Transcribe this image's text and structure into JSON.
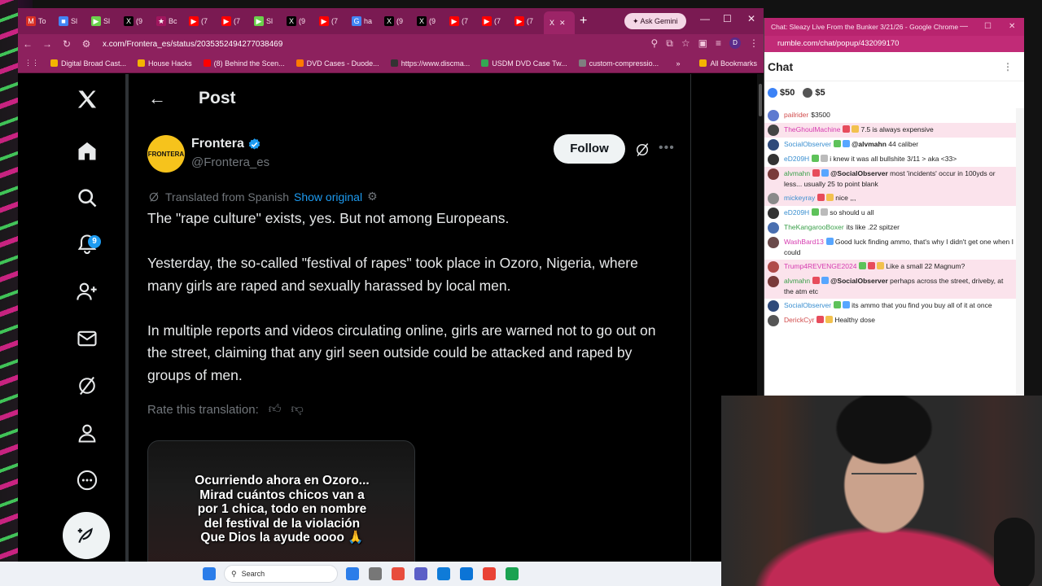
{
  "browser": {
    "tabs": [
      {
        "label": "To",
        "color": "#d93025",
        "fav": "M"
      },
      {
        "label": "Sl",
        "color": "#4285f4",
        "fav": "■"
      },
      {
        "label": "Sl",
        "color": "#6bd14b",
        "fav": "▶"
      },
      {
        "label": "(9",
        "color": "#000000",
        "fav": "X"
      },
      {
        "label": "Bc",
        "color": "#a0165e",
        "fav": "★"
      },
      {
        "label": "(7",
        "color": "#ff0000",
        "fav": "▶"
      },
      {
        "label": "(7",
        "color": "#ff0000",
        "fav": "▶"
      },
      {
        "label": "Sl",
        "color": "#6bd14b",
        "fav": "▶"
      },
      {
        "label": "(9",
        "color": "#000000",
        "fav": "X"
      },
      {
        "label": "(7",
        "color": "#ff0000",
        "fav": "▶"
      },
      {
        "label": "ha",
        "color": "#4285f4",
        "fav": "G"
      },
      {
        "label": "(9",
        "color": "#000000",
        "fav": "X"
      },
      {
        "label": "(9",
        "color": "#000000",
        "fav": "X"
      },
      {
        "label": "(7",
        "color": "#ff0000",
        "fav": "▶"
      },
      {
        "label": "(7",
        "color": "#ff0000",
        "fav": "▶"
      },
      {
        "label": "(7",
        "color": "#ff0000",
        "fav": "▶"
      }
    ],
    "active_tab_icon": "X",
    "new_tab": "+",
    "gemini_label": "Ask Gemini",
    "url": "x.com/Frontera_es/status/2035352494277038469",
    "avatar_letter": "D",
    "bookmarks": [
      {
        "label": "Digital Broad Cast...",
        "color": "#f4b400"
      },
      {
        "label": "House Hacks",
        "color": "#f4b400"
      },
      {
        "label": "(8) Behind the Scen...",
        "color": "#ff0000"
      },
      {
        "label": "DVD Cases - Duode...",
        "color": "#ff7a00"
      },
      {
        "label": "https://www.discma...",
        "color": "#333333"
      },
      {
        "label": "USDM DVD Case Tw...",
        "color": "#34a853"
      },
      {
        "label": "custom-compressio...",
        "color": "#7f7f7f"
      }
    ],
    "all_bookmarks": "All Bookmarks"
  },
  "x": {
    "notif_count": "9",
    "post_title": "Post",
    "author": {
      "avatar_text": "FRONTERA",
      "name": "Frontera",
      "handle": "@Frontera_es",
      "follow": "Follow"
    },
    "translated_label": "Translated from Spanish",
    "show_original": "Show original",
    "paragraphs": [
      "The \"rape culture\" exists, yes. But not among Europeans.",
      "Yesterday, the so-called \"festival of rapes\" took place in Ozoro, Nigeria, where many girls are raped and sexually harassed by local men.",
      "In multiple reports and videos circulating online, girls are warned not to go out on the street, claiming that any girl seen outside could be attacked and raped by groups of men."
    ],
    "rate_label": "Rate this translation:",
    "media_caption": [
      "Ocurriendo ahora en Ozoro...",
      "Mirad cuántos chicos van a",
      "por 1 chica, todo en nombre",
      "del festival de la violación",
      "Que Dios la ayude oooo 🙏"
    ],
    "colors": {
      "accent": "#1d9bf0",
      "background": "#000000"
    }
  },
  "chat": {
    "titlebar": "Chat: Sleazy Live From the Bunker 3/21/26 - Google Chrome",
    "url": "rumble.com/chat/popup/432099170",
    "header": "Chat",
    "rants": [
      {
        "amount": "$50",
        "color": "#3b82f6"
      },
      {
        "amount": "$5",
        "color": "#555555"
      }
    ],
    "messages": [
      {
        "user": "pailrider",
        "color": "#d14b4b",
        "av": "#5e7ad0",
        "badges": [],
        "mention": "",
        "text": "$3500",
        "hl": false
      },
      {
        "user": "TheGhoulMachine",
        "color": "#d63bb0",
        "av": "#444444",
        "badges": [
          "#e74c5c",
          "#f2c14e"
        ],
        "mention": "",
        "text": "7.5 is always expensive",
        "hl": true
      },
      {
        "user": "SocialObserver",
        "color": "#3a8fd0",
        "av": "#2f4a7a",
        "badges": [
          "#5ec25a",
          "#57a6ff"
        ],
        "mention": "@alvmahn",
        "text": "44 caliber",
        "hl": false
      },
      {
        "user": "eD209H",
        "color": "#3a8fd0",
        "av": "#333333",
        "badges": [
          "#5ec25a",
          "#bbbbbb"
        ],
        "mention": "",
        "text": "i knew it was all bullshite 3/11 > aka <33>",
        "hl": false
      },
      {
        "user": "alvmahn",
        "color": "#3aa04a",
        "av": "#7a3a3a",
        "badges": [
          "#e74c5c",
          "#57a6ff"
        ],
        "mention": "@SocialObserver",
        "text": "most 'incidents' occur in 100yds or less... usually 25 to point blank",
        "hl": true
      },
      {
        "user": "mickeyray",
        "color": "#3a8fd0",
        "av": "#8a8a8a",
        "badges": [
          "#e74c5c",
          "#f2c14e"
        ],
        "mention": "",
        "text": "nice ,,,",
        "hl": true
      },
      {
        "user": "eD209H",
        "color": "#3a8fd0",
        "av": "#333333",
        "badges": [
          "#5ec25a",
          "#bbbbbb"
        ],
        "mention": "",
        "text": "so should u all",
        "hl": false
      },
      {
        "user": "TheKangarooBoxer",
        "color": "#3aa04a",
        "av": "#4a6fb0",
        "badges": [],
        "mention": "",
        "text": "its like .22 spitzer",
        "hl": false
      },
      {
        "user": "WashBard13",
        "color": "#d63bb0",
        "av": "#6a4a4a",
        "badges": [
          "#57a6ff"
        ],
        "mention": "",
        "text": "Good luck finding ammo, that's why I didn't get one when I could",
        "hl": false
      },
      {
        "user": "Trump4REVENGE2024",
        "color": "#d63bb0",
        "av": "#b04a4a",
        "badges": [
          "#5ec25a",
          "#e74c5c",
          "#f2c14e"
        ],
        "mention": "",
        "text": "Like a small 22 Magnum?",
        "hl": true
      },
      {
        "user": "alvmahn",
        "color": "#3aa04a",
        "av": "#7a3a3a",
        "badges": [
          "#e74c5c",
          "#57a6ff"
        ],
        "mention": "@SocialObserver",
        "text": "perhaps across the street, driveby, at the atm etc",
        "hl": true
      },
      {
        "user": "SocialObserver",
        "color": "#3a8fd0",
        "av": "#2f4a7a",
        "badges": [
          "#5ec25a",
          "#57a6ff"
        ],
        "mention": "",
        "text": "its ammo that you find you buy all of it at once",
        "hl": false
      },
      {
        "user": "DerickCyr",
        "color": "#d14b4b",
        "av": "#555555",
        "badges": [
          "#e74c5c",
          "#f2c14e"
        ],
        "mention": "",
        "text": "Healthy dose",
        "hl": false
      }
    ]
  },
  "taskbar": {
    "search_label": "Search",
    "icons": [
      "#2b7de9",
      "#777777",
      "#e84d3d",
      "#5b5fc7",
      "#0f7bd8",
      "#0b74d6",
      "#e94235",
      "#1aa251"
    ]
  }
}
